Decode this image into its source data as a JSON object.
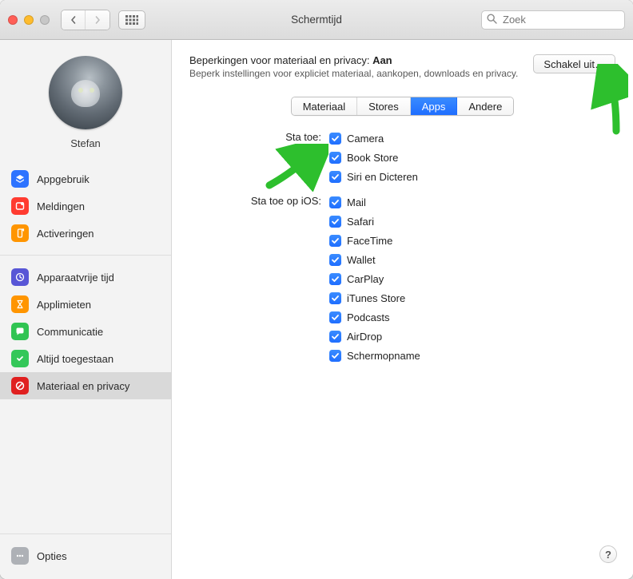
{
  "window": {
    "title": "Schermtijd",
    "search_placeholder": "Zoek"
  },
  "user": {
    "name": "Stefan"
  },
  "sidebar": {
    "group1": [
      {
        "label": "Appgebruik"
      },
      {
        "label": "Meldingen"
      },
      {
        "label": "Activeringen"
      }
    ],
    "group2": [
      {
        "label": "Apparaatvrije tijd"
      },
      {
        "label": "Applimieten"
      },
      {
        "label": "Communicatie"
      },
      {
        "label": "Altijd toegestaan"
      },
      {
        "label": "Materiaal en privacy"
      }
    ],
    "options_label": "Opties"
  },
  "header": {
    "title_prefix": "Beperkingen voor materiaal en privacy: ",
    "title_state": "Aan",
    "subtitle": "Beperk instellingen voor expliciet materiaal, aankopen, downloads en privacy.",
    "toggle_button": "Schakel uit…"
  },
  "tabs": {
    "items": [
      "Materiaal",
      "Stores",
      "Apps",
      "Andere"
    ],
    "selected_index": 2
  },
  "allow": {
    "label": "Sta toe:",
    "items": [
      {
        "label": "Camera",
        "checked": true
      },
      {
        "label": "Book Store",
        "checked": true
      },
      {
        "label": "Siri en Dicteren",
        "checked": true
      }
    ]
  },
  "allow_ios": {
    "label": "Sta toe op iOS:",
    "items": [
      {
        "label": "Mail",
        "checked": true
      },
      {
        "label": "Safari",
        "checked": true
      },
      {
        "label": "FaceTime",
        "checked": true
      },
      {
        "label": "Wallet",
        "checked": true
      },
      {
        "label": "CarPlay",
        "checked": true
      },
      {
        "label": "iTunes Store",
        "checked": true
      },
      {
        "label": "Podcasts",
        "checked": true
      },
      {
        "label": "AirDrop",
        "checked": true
      },
      {
        "label": "Schermopname",
        "checked": true
      }
    ]
  },
  "help_label": "?"
}
